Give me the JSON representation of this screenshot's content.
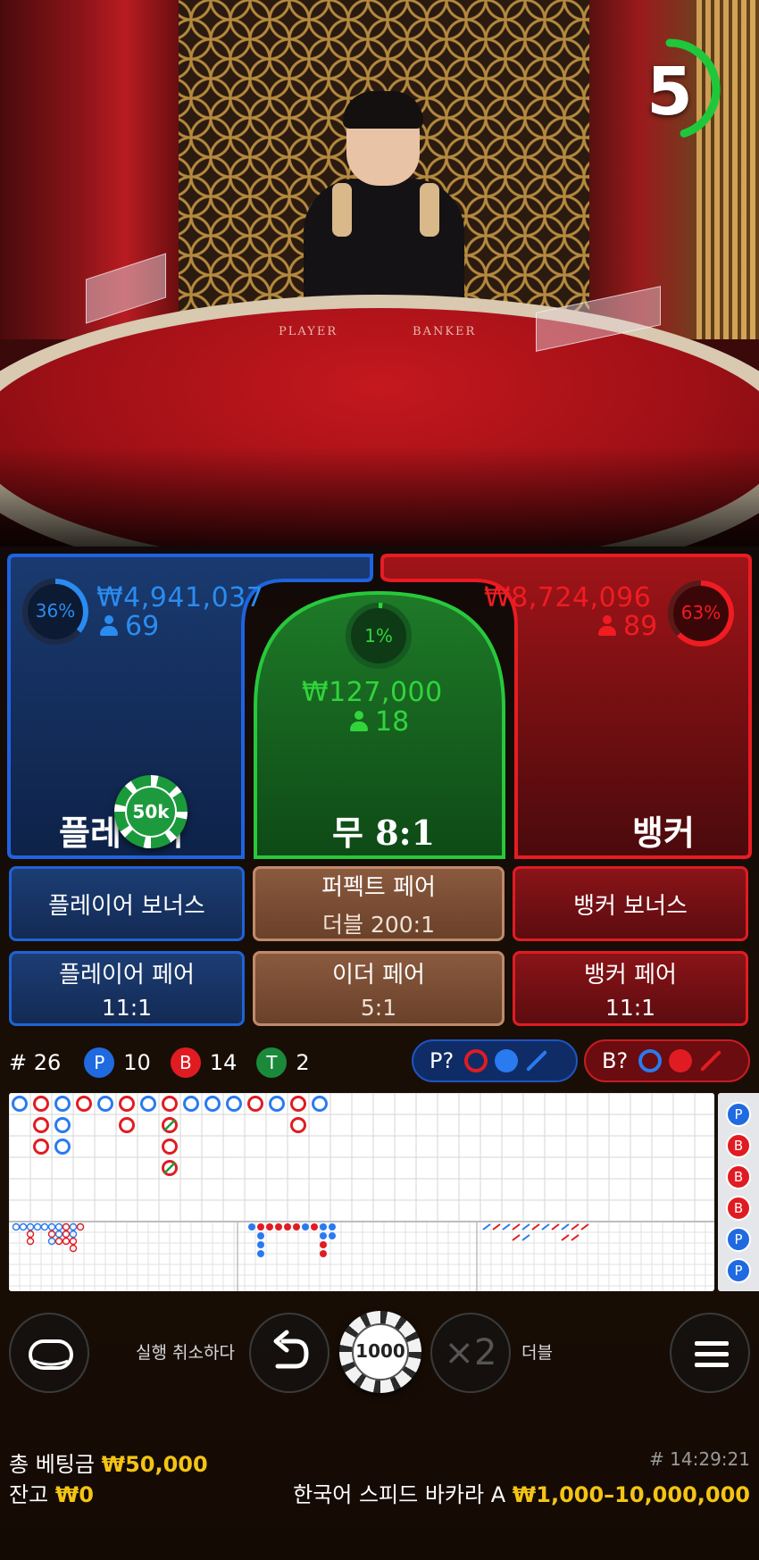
{
  "timer": {
    "seconds": "5",
    "progress": 0.45
  },
  "table_felt": {
    "player_text": "PLAYER",
    "banker_text": "BANKER"
  },
  "player": {
    "percent": "36%",
    "amount": "₩4,941,037",
    "players": "69",
    "label": "플레이어",
    "color": "#2a8cf0"
  },
  "tie": {
    "percent": "1%",
    "amount": "₩127,000",
    "players": "18",
    "label": "무",
    "odds": "8:1",
    "color": "#32d43c"
  },
  "banker": {
    "percent": "63%",
    "amount": "₩8,724,096",
    "players": "89",
    "label": "뱅커",
    "color": "#f01c22"
  },
  "placed_chip": {
    "value": "50k",
    "zone": "player"
  },
  "side_bets": [
    {
      "label": "플레이어 보너스",
      "odds": ""
    },
    {
      "label": "퍼펙트 페어",
      "odds": "더블 200:1"
    },
    {
      "label": "뱅커 보너스",
      "odds": ""
    },
    {
      "label": "플레이어 페어",
      "odds": "11:1"
    },
    {
      "label": "이더 페어",
      "odds": "5:1"
    },
    {
      "label": "뱅커 페어",
      "odds": "11:1"
    }
  ],
  "stats": {
    "round": "# 26",
    "player_badge": "P",
    "player_count": "10",
    "banker_badge": "B",
    "banker_count": "14",
    "tie_badge": "T",
    "tie_count": "2"
  },
  "predictions": {
    "player_label": "P?",
    "banker_label": "B?"
  },
  "road_side": [
    "P",
    "B",
    "B",
    "B",
    "P",
    "P"
  ],
  "controls": {
    "undo_label": "실행 취소하다",
    "chip_value": "1000",
    "double_symbol": "×2",
    "double_label": "더블"
  },
  "footer": {
    "total_bet_label": "총 베팅금",
    "total_bet": "₩50,000",
    "balance_label": "잔고",
    "balance": "₩0",
    "round_time": "# 14:29:21",
    "table_name": "한국어 스피드 바카라 A",
    "limits": "₩1,000–10,000,000"
  }
}
